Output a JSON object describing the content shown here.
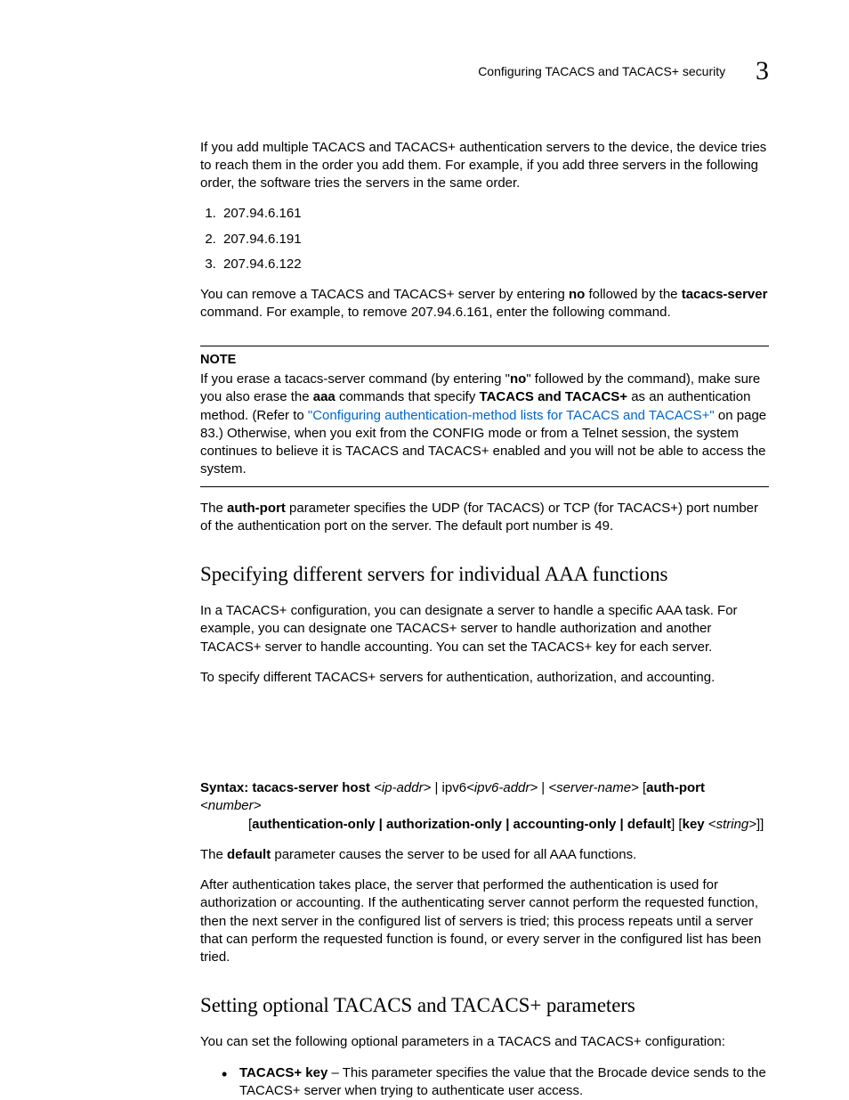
{
  "header": {
    "section": "Configuring TACACS and TACACS+ security",
    "chapter": "3"
  },
  "intro": "If you add multiple TACACS and TACACS+ authentication servers to the device, the device tries to reach them in the order you add them. For example, if you add three servers in the following order, the software tries the servers in the same order.",
  "ips": [
    "207.94.6.161",
    "207.94.6.191",
    "207.94.6.122"
  ],
  "remove_1": "You can remove a TACACS and TACACS+ server by entering ",
  "remove_no": "no",
  "remove_2": " followed by the ",
  "remove_cmd": "tacacs-server",
  "remove_3": " command.  For example, to remove 207.94.6.161, enter the following command.",
  "note": {
    "title": "NOTE",
    "t1": "If you erase a tacacs-server command (by entering \"",
    "no": "no",
    "t2": "\" followed by the command), make sure you also erase the ",
    "aaa": "aaa",
    "t3": " commands that specify ",
    "tac": "TACACS and TACACS+",
    "t4": " as an authentication method. (Refer to ",
    "link": "\"Configuring authentication-method lists for TACACS and TACACS+\"",
    "t5": " on page 83.) Otherwise, when you exit from the CONFIG mode or from a Telnet session, the system continues to believe it is TACACS and TACACS+ enabled and you will not be able to access the system."
  },
  "authport_1": "The ",
  "authport_b": "auth-port",
  "authport_2": " parameter specifies the UDP (for TACACS) or TCP (for TACACS+) port number of the authentication port on the server.  The default port number is 49.",
  "h2_a": "Specifying different servers for individual AAA functions",
  "para_a1": "In a TACACS+ configuration, you can designate a server to handle a specific AAA task.  For example, you can designate one TACACS+ server to handle authorization and another TACACS+ server to handle accounting. You can set the TACACS+ key for each server.",
  "para_a2": "To specify different TACACS+ servers for authentication, authorization, and accounting.",
  "syntax": {
    "lbl": "Syntax:  tacacs-server host",
    "ip": "<ip-addr>",
    "pipe1": " | ipv6",
    "ipv6": "<ipv6-addr>",
    "pipe2": "  | ",
    "srv": "<server-name>",
    "sp": " [",
    "ap": "auth-port",
    "num": " <number>",
    "l2a": "[",
    "l2b": "authentication-only | authorization-only | accounting-only | default",
    "l2c": "] [",
    "l2d": "key",
    "l2e": " <string>",
    "l2f": "]]"
  },
  "default_1": "The ",
  "default_b": "default",
  "default_2": " parameter causes the server to be used for all AAA functions.",
  "after_auth": "After authentication takes place, the server that performed the authentication is used for authorization or accounting.  If the authenticating server cannot perform the requested function, then the next server in the configured list of servers is tried; this process repeats until a server that can perform the requested function is found, or every server in the configured list has been tried.",
  "h2_b": "Setting optional TACACS and TACACS+ parameters",
  "para_b1": "You can set the following optional parameters in a TACACS and TACACS+ configuration:",
  "bullet": {
    "b": "TACACS+ key",
    "t": " – This parameter specifies the value that the Brocade device sends to the TACACS+ server when trying to authenticate user access."
  }
}
